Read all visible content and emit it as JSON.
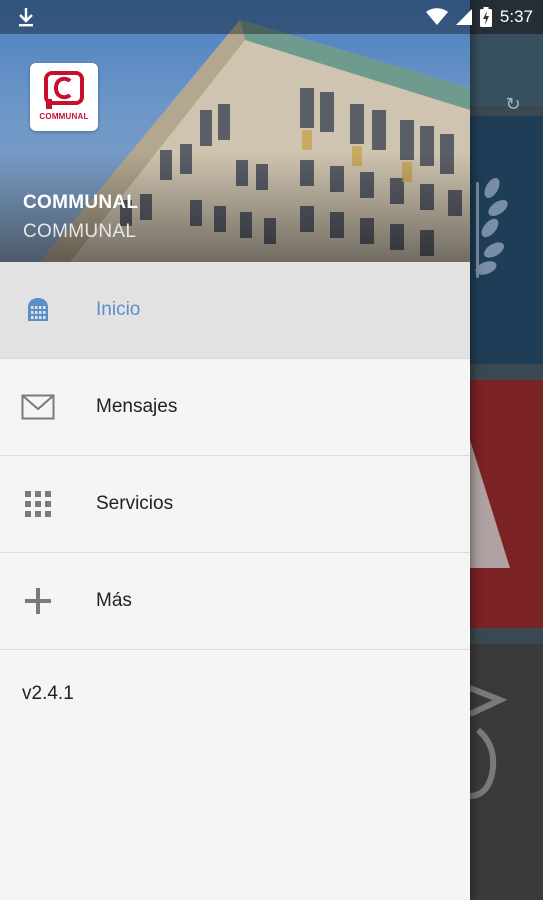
{
  "status_bar": {
    "time": "5:37",
    "icons": [
      "download-icon",
      "wifi-icon",
      "signal-icon",
      "battery-charging-icon"
    ]
  },
  "drawer": {
    "header": {
      "logo_text": "COMMUNAL",
      "title": "COMMUNAL",
      "subtitle": "COMMUNAL"
    },
    "menu": [
      {
        "label": "Inicio",
        "icon": "building-icon",
        "active": true
      },
      {
        "label": "Mensajes",
        "icon": "envelope-icon",
        "active": false
      },
      {
        "label": "Servicios",
        "icon": "grid-icon",
        "active": false
      },
      {
        "label": "Más",
        "icon": "plus-icon",
        "active": false
      }
    ],
    "version": "v2.4.1"
  },
  "colors": {
    "accent": "#5b8fc7",
    "brand_red": "#c8102e",
    "drawer_bg": "#f5f5f5",
    "active_bg": "#e2e2e2"
  }
}
